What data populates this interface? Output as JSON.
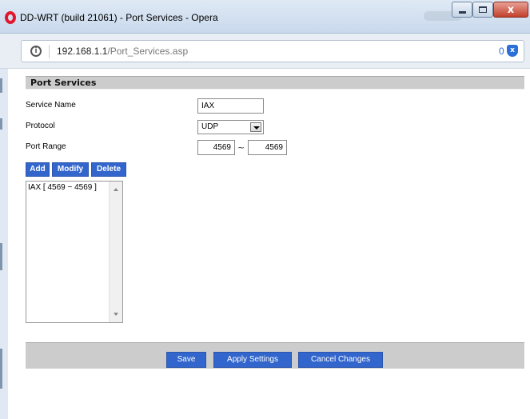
{
  "window": {
    "title": "DD-WRT (build 21061) - Port Services - Opera",
    "minimize_icon": "minimize-icon",
    "maximize_icon": "maximize-icon",
    "close_icon": "close-icon",
    "close_glyph": "x"
  },
  "address_bar": {
    "host": "192.168.1.1",
    "path": "/Port_Services.asp",
    "info_glyph": "i",
    "adblock_count": "0",
    "shield_glyph": "x"
  },
  "section": {
    "title": "Port Services"
  },
  "form": {
    "service_name_label": "Service Name",
    "service_name_value": "IAX",
    "protocol_label": "Protocol",
    "protocol_value": "UDP",
    "port_range_label": "Port Range",
    "port_start": "4569",
    "port_separator": "~",
    "port_end": "4569"
  },
  "actions": {
    "add": "Add",
    "modify": "Modify",
    "delete": "Delete"
  },
  "service_list": {
    "items": [
      "IAX [ 4569 ~ 4569 ]"
    ]
  },
  "footer": {
    "save": "Save",
    "apply": "Apply Settings",
    "cancel": "Cancel Changes"
  },
  "colors": {
    "button_blue": "#3366cc",
    "header_gray": "#cccccc",
    "opera_red": "#e2172e"
  }
}
